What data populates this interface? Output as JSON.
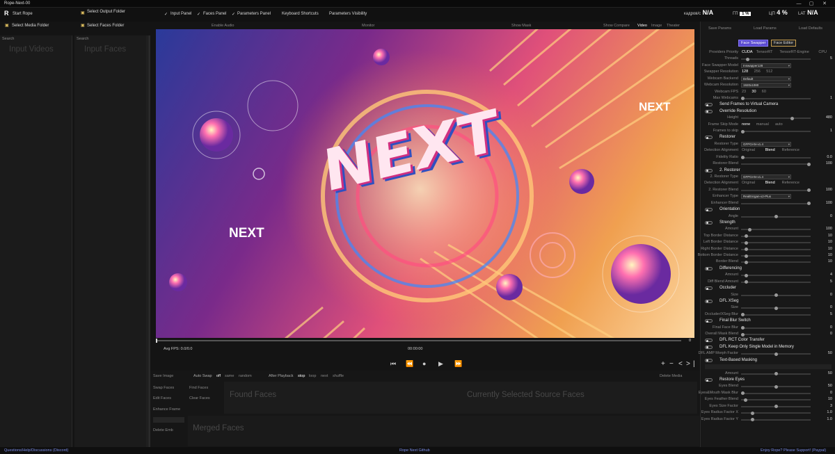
{
  "window": {
    "title": "Rope-Next-00",
    "min": "—",
    "max": "▢",
    "close": "✕"
  },
  "menu": {
    "start_rope": "Start Rope",
    "select_output_folder": "Select Output Folder",
    "select_media_folder": "Select Media Folder",
    "select_faces_folder": "Select Faces Folder",
    "input_panel": "Input Panel",
    "faces_panel": "Faces Panel",
    "parameters_panel": "Parameters Panel",
    "keyboard_shortcuts": "Keyboard Shortcuts",
    "parameters_visibility": "Parameters Visibility"
  },
  "stats": {
    "fps_label": "кадров/с",
    "fps_value": "N/A",
    "gpu_label": "ГП",
    "gpu_value": "1 %",
    "cpu_label": "ЦП",
    "cpu_value": "4 %",
    "lat_label": "LAT",
    "lat_value": "N/A"
  },
  "left_panels": {
    "search1": "Search",
    "search2": "Search",
    "input_videos": "Input Videos",
    "input_faces": "Input Faces"
  },
  "center_top": {
    "enable_audio": "Enable Audio",
    "monitor": "Monitor",
    "show_mask": "Show Mask",
    "show_compare": "Show Compare",
    "video": "Video",
    "image": "Image",
    "theater": "Theater"
  },
  "video_text": {
    "next_main": "NEXT",
    "next_left": "NEXT",
    "next_right": "NEXT"
  },
  "timeline": {
    "avg_fps": "Avg FPS: 0.0/0.0",
    "time": "00:00:00",
    "frame": "0"
  },
  "transport": {
    "first": "⏮",
    "prev": "⏪",
    "stop": "●",
    "play": "▶",
    "next": "⏩",
    "plus": "+",
    "minus": "−",
    "left": "<",
    "right": ">",
    "line": "|"
  },
  "bottom": {
    "save_image": "Save Image",
    "auto_swap": "Auto Swap",
    "off": "off",
    "same": "same",
    "random": "random",
    "after_playback": "After Playback",
    "stop": "stop",
    "loop": "loop",
    "next": "next",
    "shuffle": "shuffle",
    "delete_media": "Delete Media",
    "swap_faces": "Swap Faces",
    "find_faces": "Find Faces",
    "edit_faces": "Edit Faces",
    "clear_faces": "Clear Faces",
    "enhance_frame": "Enhance Frame",
    "delete_emb": "Delete Emb",
    "found_faces": "Found Faces",
    "selected_faces": "Currently Selected Source Faces",
    "merged_faces": "Merged Faces"
  },
  "right": {
    "save_params": "Save Params",
    "load_params": "Load Params",
    "load_defaults": "Load Defaults",
    "tab_swapper": "Face Swapper",
    "tab_editor": "Face Editor"
  },
  "params": [
    {
      "kind": "opts",
      "label": "Providers Priority",
      "opts": [
        "CUDA",
        "TensorRT",
        "TensorRT-Engine",
        "CPU"
      ],
      "sel": 0
    },
    {
      "kind": "slider",
      "label": "Threads",
      "value": "5",
      "pos": 0.07
    },
    {
      "kind": "select",
      "label": "Face Swapper Model",
      "value": "Inswapper128"
    },
    {
      "kind": "opts",
      "label": "Swapper Resolution",
      "opts": [
        "128",
        "256",
        "512"
      ],
      "sel": 0
    },
    {
      "kind": "select",
      "label": "Webcam Backend",
      "value": "Default"
    },
    {
      "kind": "select",
      "label": "Webcam Resolution",
      "value": "1920x1080"
    },
    {
      "kind": "opts",
      "label": "Webcam FPS",
      "opts": [
        "23",
        "30",
        "60"
      ],
      "sel": 1
    },
    {
      "kind": "slider",
      "label": "Max Webcams",
      "value": "1",
      "pos": 0.0
    },
    {
      "kind": "toggle",
      "label": "Send Frames to Virtual Camera"
    },
    {
      "kind": "toggle",
      "label": "Override Resolution"
    },
    {
      "kind": "slider",
      "label": "Height",
      "value": "480",
      "pos": 0.75
    },
    {
      "kind": "opts",
      "label": "Frame Skip Mode",
      "opts": [
        "none",
        "manual",
        "auto"
      ],
      "sel": 0
    },
    {
      "kind": "slider",
      "label": "Frames to skip",
      "value": "1",
      "pos": 0.0
    },
    {
      "kind": "toggle",
      "label": "Restorer"
    },
    {
      "kind": "select",
      "label": "Restorer Type",
      "value": "GFPGAN-v1.4"
    },
    {
      "kind": "opts",
      "label": "Detection Alignment",
      "opts": [
        "Original",
        "Blend",
        "Reference"
      ],
      "sel": 1
    },
    {
      "kind": "slider",
      "label": "Fidelity Ratio",
      "value": "0.0",
      "pos": 0.0
    },
    {
      "kind": "slider",
      "label": "Restorer Blend",
      "value": "100",
      "pos": 1.0
    },
    {
      "kind": "toggle",
      "label": "2. Restorer"
    },
    {
      "kind": "select",
      "label": "2. Restorer Type",
      "value": "GFPGAN-v1.4"
    },
    {
      "kind": "opts",
      "label": "Detection Alignment",
      "opts": [
        "Original",
        "Blend",
        "Reference"
      ],
      "sel": 1
    },
    {
      "kind": "slider",
      "label": "2. Restorer Blend",
      "value": "100",
      "pos": 1.0
    },
    {
      "kind": "select",
      "label": "Enhancer Type",
      "value": "RealEsrgan-x2-Plus"
    },
    {
      "kind": "slider",
      "label": "Enhancer Blend",
      "value": "100",
      "pos": 1.0
    },
    {
      "kind": "toggle",
      "label": "Orientation"
    },
    {
      "kind": "slider",
      "label": "Angle",
      "value": "0",
      "pos": 0.5
    },
    {
      "kind": "toggle",
      "label": "Strength"
    },
    {
      "kind": "slider",
      "label": "Amount",
      "value": "100",
      "pos": 0.1
    },
    {
      "kind": "slider",
      "label": "Top Border Distance",
      "value": "10",
      "pos": 0.05
    },
    {
      "kind": "slider",
      "label": "Left Border Distance",
      "value": "10",
      "pos": 0.05
    },
    {
      "kind": "slider",
      "label": "Right Border Distance",
      "value": "10",
      "pos": 0.05
    },
    {
      "kind": "slider",
      "label": "Bottom Border Distance",
      "value": "10",
      "pos": 0.05
    },
    {
      "kind": "slider",
      "label": "Border Blend",
      "value": "10",
      "pos": 0.05
    },
    {
      "kind": "toggle",
      "label": "Differencing"
    },
    {
      "kind": "slider",
      "label": "Amount",
      "value": "4",
      "pos": 0.05
    },
    {
      "kind": "slider",
      "label": "Diff Blend Amount",
      "value": "5",
      "pos": 0.05
    },
    {
      "kind": "toggle",
      "label": "Occluder"
    },
    {
      "kind": "slider",
      "label": "Size",
      "value": "0",
      "pos": 0.5
    },
    {
      "kind": "toggle",
      "label": "DFL XSeg"
    },
    {
      "kind": "slider",
      "label": "Size",
      "value": "0",
      "pos": 0.5
    },
    {
      "kind": "slider",
      "label": "Occluder/XSeg Blur",
      "value": "5",
      "pos": 0.0
    },
    {
      "kind": "toggle",
      "label": "Final Blur Switch"
    },
    {
      "kind": "slider",
      "label": "Final Face Blur",
      "value": "0",
      "pos": 0.0
    },
    {
      "kind": "slider",
      "label": "Overall Mask Blend",
      "value": "0",
      "pos": 0.0
    },
    {
      "kind": "toggle",
      "label": "DFL RCT Color Transfer"
    },
    {
      "kind": "toggle",
      "label": "DFL Keep Only Single Model in Memory"
    },
    {
      "kind": "slider",
      "label": "DFL AMP Morph Factor",
      "value": "50",
      "pos": 0.5
    },
    {
      "kind": "toggle",
      "label": "Text-Based Masking"
    },
    {
      "kind": "input",
      "label": "Text",
      "value": ""
    },
    {
      "kind": "slider",
      "label": "Amount",
      "value": "50",
      "pos": 0.5
    },
    {
      "kind": "toggle",
      "label": "Restore Eyes"
    },
    {
      "kind": "slider",
      "label": "Eyes Blend",
      "value": "50",
      "pos": 0.5
    },
    {
      "kind": "slider",
      "label": "Eyes&Mouth Mask Blur",
      "value": "0",
      "pos": 0.0
    },
    {
      "kind": "slider",
      "label": "Eyes Feather Blend",
      "value": "10",
      "pos": 0.04
    },
    {
      "kind": "slider",
      "label": "Eyes Size Factor",
      "value": "3",
      "pos": 0.5
    },
    {
      "kind": "slider",
      "label": "Eyes Radius Factor X",
      "value": "1.0",
      "pos": 0.15
    },
    {
      "kind": "slider",
      "label": "Eyes Radius Factor Y",
      "value": "1.0",
      "pos": 0.15
    }
  ],
  "footer": {
    "help": "Questions/Help/Discussions (Discord)",
    "github": "Rope Next Github",
    "support": "Enjoy Rope? Please Support! (Paypal)"
  }
}
